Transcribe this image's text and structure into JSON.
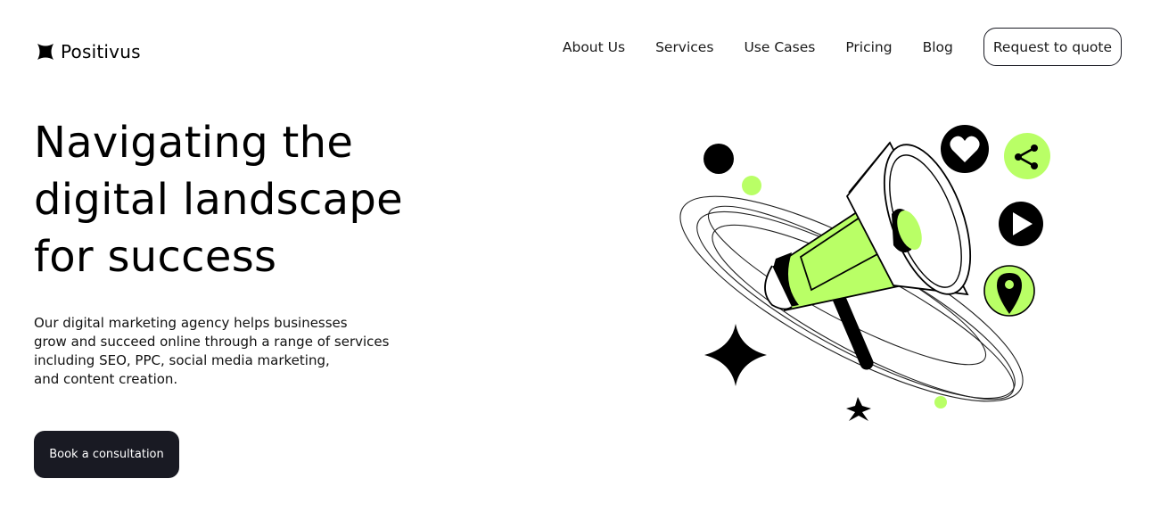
{
  "brand": {
    "name": "Positivus"
  },
  "nav": {
    "links": [
      "About Us",
      "Services",
      "Use Cases",
      "Pricing",
      "Blog"
    ],
    "cta_label": "Request to quote"
  },
  "hero": {
    "title_lines": [
      "Navigating the",
      "digital landscape",
      "for success"
    ],
    "description_lines": [
      "Our digital marketing agency helps businesses",
      "grow and succeed online through a range of services",
      "including SEO, PPC, social media marketing,",
      "and content creation."
    ],
    "cta_label": "Book a consultation"
  },
  "colors": {
    "accent": "#b9ff66",
    "dark": "#191a23",
    "background": "#ffffff"
  },
  "illustration": {
    "icons": [
      "megaphone-icon",
      "heart-icon",
      "share-icon",
      "play-icon",
      "location-pin-icon",
      "star-icon"
    ]
  }
}
